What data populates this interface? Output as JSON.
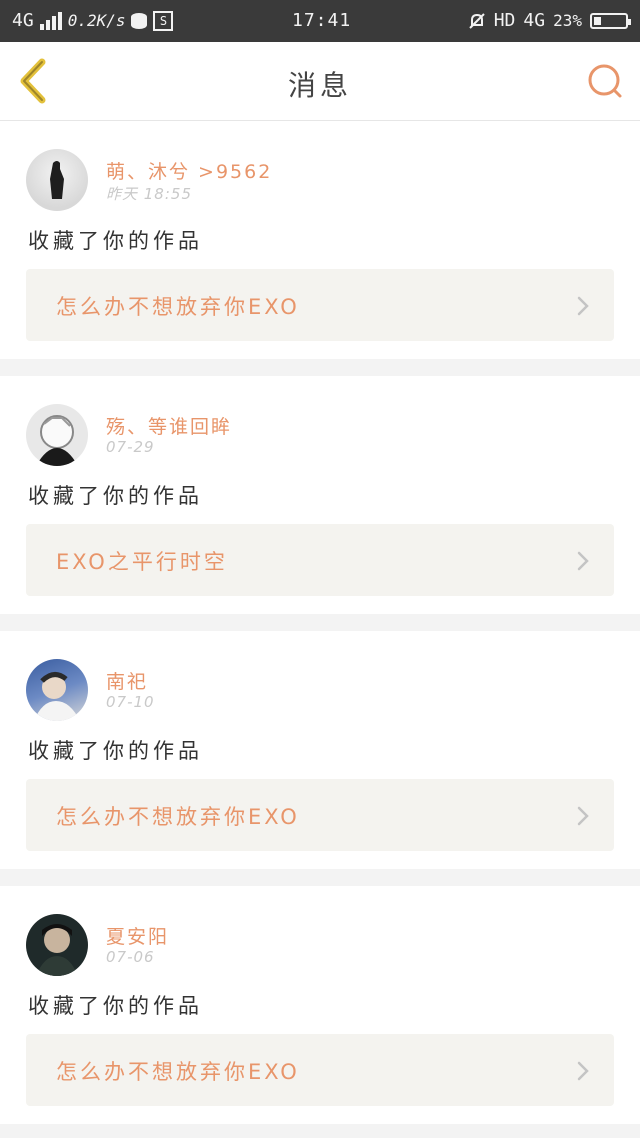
{
  "status_bar": {
    "network": "4G",
    "speed": "0.2K/s",
    "time": "17:41",
    "hd": "HD",
    "network2": "4G",
    "battery": "23%",
    "battery_level": 0.23
  },
  "header": {
    "title": "消息",
    "back_icon": "chevron-left-icon",
    "search_icon": "search-icon"
  },
  "colors": {
    "accent": "#e8956a",
    "back": "#e3c13b",
    "card_bg": "#ffffff",
    "work_bg": "#f4f3ef"
  },
  "messages": [
    {
      "user": "萌、沐兮 >9562",
      "time": "昨天 18:55",
      "action": "收藏了你的作品",
      "work": "怎么办不想放弃你EXO"
    },
    {
      "user": "殇、等谁回眸",
      "time": "07-29",
      "action": "收藏了你的作品",
      "work": "EXO之平行时空"
    },
    {
      "user": "南祀",
      "time": "07-10",
      "action": "收藏了你的作品",
      "work": "怎么办不想放弃你EXO"
    },
    {
      "user": "夏安阳",
      "time": "07-06",
      "action": "收藏了你的作品",
      "work": "怎么办不想放弃你EXO"
    }
  ]
}
